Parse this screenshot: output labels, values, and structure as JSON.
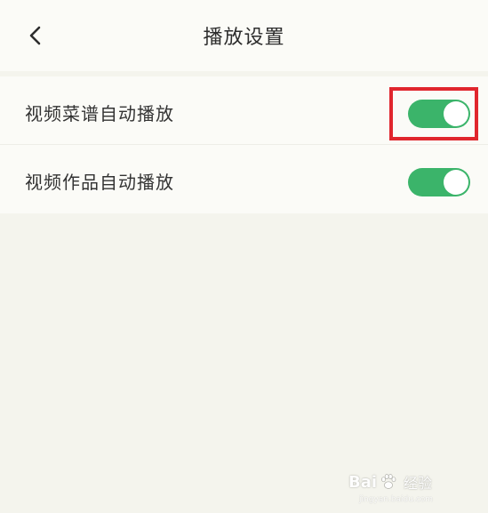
{
  "header": {
    "title": "播放设置"
  },
  "settings": {
    "items": [
      {
        "label": "视频菜谱自动播放",
        "enabled": true
      },
      {
        "label": "视频作品自动播放",
        "enabled": true
      }
    ]
  },
  "colors": {
    "toggle_on": "#3bb46a",
    "highlight": "#e0262d",
    "background": "#f4f4ed"
  },
  "watermark": {
    "brand_left": "Bai",
    "brand_right": "经验",
    "url": "jingyan.baidu.com"
  }
}
